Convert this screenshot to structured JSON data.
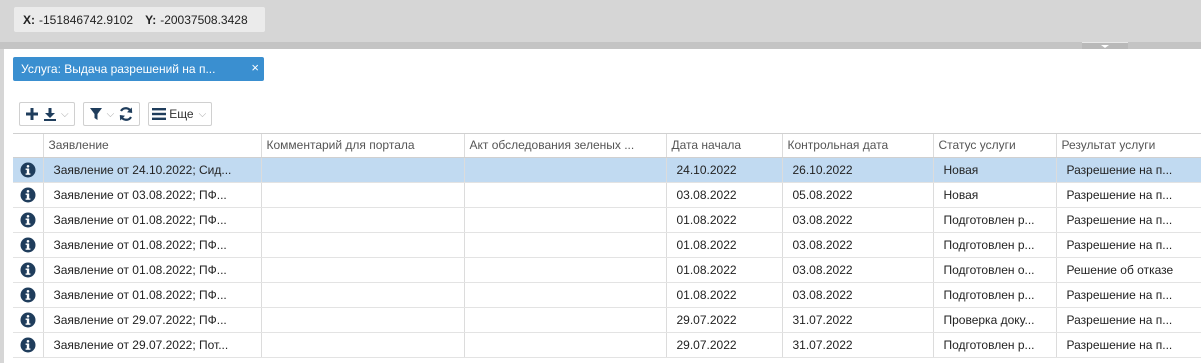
{
  "coords": {
    "x_label": "X:",
    "x_value": "-151846742.9102",
    "y_label": "Y:",
    "y_value": "-20037508.3428"
  },
  "filter_tag": {
    "label": "Услуга: Выдача разрешений на п...",
    "close_glyph": "×"
  },
  "toolbar": {
    "more_label": "Еще",
    "caret": "⌵"
  },
  "grid": {
    "columns": [
      "",
      "Заявление",
      "Комментарий для портала",
      "Акт обследования зеленых ...",
      "Дата начала",
      "Контрольная дата",
      "Статус услуги",
      "Результат услуги"
    ],
    "rows": [
      {
        "selected": true,
        "statement": "Заявление от 24.10.2022; Сид...",
        "comment": "",
        "act": "",
        "start": "24.10.2022",
        "control": "26.10.2022",
        "status": "Новая",
        "result": "Разрешение на п..."
      },
      {
        "selected": false,
        "statement": "Заявление от 03.08.2022; ПФ...",
        "comment": "",
        "act": "",
        "start": "03.08.2022",
        "control": "05.08.2022",
        "status": "Новая",
        "result": "Разрешение на п..."
      },
      {
        "selected": false,
        "statement": "Заявление от 01.08.2022; ПФ...",
        "comment": "",
        "act": "",
        "start": "01.08.2022",
        "control": "03.08.2022",
        "status": "Подготовлен р...",
        "result": "Разрешение на п..."
      },
      {
        "selected": false,
        "statement": "Заявление от 01.08.2022; ПФ...",
        "comment": "",
        "act": "",
        "start": "01.08.2022",
        "control": "03.08.2022",
        "status": "Подготовлен р...",
        "result": "Разрешение на п..."
      },
      {
        "selected": false,
        "statement": "Заявление от 01.08.2022; ПФ...",
        "comment": "",
        "act": "",
        "start": "01.08.2022",
        "control": "03.08.2022",
        "status": "Подготовлен о...",
        "result": "Решение об отказе"
      },
      {
        "selected": false,
        "statement": "Заявление от 01.08.2022; ПФ...",
        "comment": "",
        "act": "",
        "start": "01.08.2022",
        "control": "03.08.2022",
        "status": "Подготовлен р...",
        "result": "Разрешение на п..."
      },
      {
        "selected": false,
        "statement": "Заявление от 29.07.2022; ПФ...",
        "comment": "",
        "act": "",
        "start": "29.07.2022",
        "control": "31.07.2022",
        "status": "Проверка доку...",
        "result": "Разрешение на п..."
      },
      {
        "selected": false,
        "statement": "Заявление от 29.07.2022; Пот...",
        "comment": "",
        "act": "",
        "start": "29.07.2022",
        "control": "31.07.2022",
        "status": "Подготовлен р...",
        "result": "Разрешение на п..."
      }
    ]
  },
  "icons": {
    "row": "info-circle-icon",
    "add": "plus-icon",
    "download": "download-icon",
    "filter": "filter-icon",
    "refresh": "refresh-icon",
    "menu": "hamburger-icon"
  },
  "colors": {
    "accent": "#3a8fd0",
    "selected_row": "#c1daf1",
    "icon_dark": "#1f3d5c"
  }
}
